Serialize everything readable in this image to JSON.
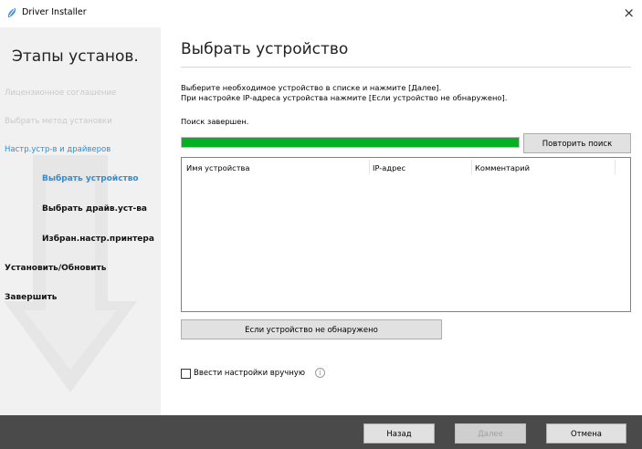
{
  "window": {
    "title": "Driver Installer",
    "close_symbol": "×",
    "app_icon": "pen-swirl-icon"
  },
  "sidebar": {
    "title": "Этапы установ.",
    "steps": [
      {
        "label": "Лицензионное соглашение",
        "state": "done"
      },
      {
        "label": "Выбрать метод установки",
        "state": "done"
      },
      {
        "label": "Настр.устр-в и драйверов",
        "state": "current-group"
      },
      {
        "label": "Выбрать устройство",
        "state": "current"
      },
      {
        "label": "Выбрать драйв.уст-ва",
        "state": "future"
      },
      {
        "label": "Избран.настр.принтера",
        "state": "future"
      },
      {
        "label": "Установить/Обновить",
        "state": "future"
      },
      {
        "label": "Завершить",
        "state": "future"
      }
    ]
  },
  "main": {
    "title": "Выбрать устройство",
    "instruction_line1": "Выберите необходимое устройство в списке и нажмите [Далее].",
    "instruction_line2": "При настройке IP-адреса устройства нажмите [Если устройство не обнаружено].",
    "status": "Поиск завершен.",
    "progress_fraction": 1.0,
    "retry_search_label": "Повторить поиск",
    "table": {
      "columns": [
        "Имя устройства",
        "IP-адрес",
        "Комментарий"
      ],
      "rows": []
    },
    "not_found_label": "Если устройство не обнаружено",
    "manual_settings_label": "Ввести настройки вручную",
    "manual_settings_checked": false,
    "info_symbol": "i"
  },
  "footer": {
    "back_label": "Назад",
    "next_label": "Далее",
    "cancel_label": "Отмена"
  },
  "colors": {
    "accent_blue": "#2f8ed8",
    "progress_green": "#06b025",
    "footer_bg": "#4a4a4a",
    "sidebar_bg": "#f1f1f1"
  }
}
